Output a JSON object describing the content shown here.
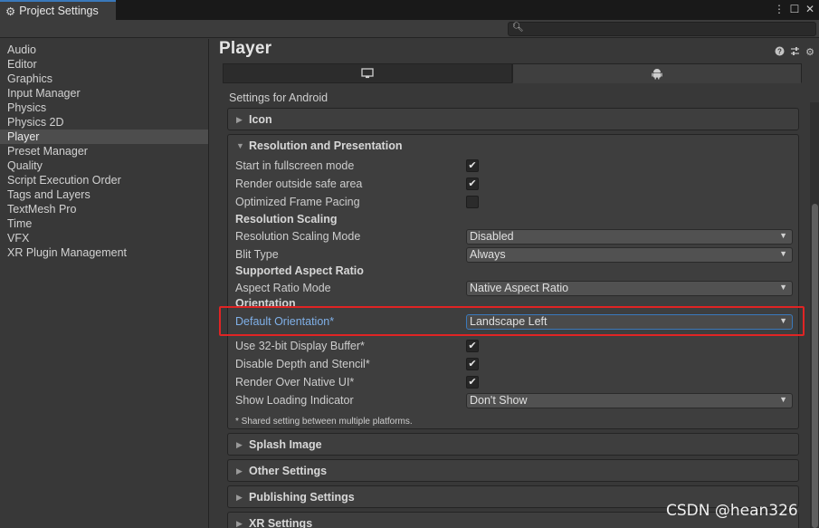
{
  "window": {
    "tab_title": "Project Settings",
    "controls": [
      "⋮",
      "☐",
      "✕"
    ]
  },
  "search": {
    "placeholder": ""
  },
  "sidebar": {
    "items": [
      {
        "label": "Audio"
      },
      {
        "label": "Editor"
      },
      {
        "label": "Graphics"
      },
      {
        "label": "Input Manager"
      },
      {
        "label": "Physics"
      },
      {
        "label": "Physics 2D"
      },
      {
        "label": "Player",
        "active": true
      },
      {
        "label": "Preset Manager"
      },
      {
        "label": "Quality"
      },
      {
        "label": "Script Execution Order"
      },
      {
        "label": "Tags and Layers"
      },
      {
        "label": "TextMesh Pro"
      },
      {
        "label": "Time"
      },
      {
        "label": "VFX"
      },
      {
        "label": "XR Plugin Management"
      }
    ]
  },
  "main": {
    "title": "Player",
    "header_icons": [
      "help-icon",
      "preset-icon",
      "gear-icon"
    ],
    "platform_tabs": [
      "desktop-icon",
      "android-icon"
    ],
    "settings_for": "Settings for Android",
    "icon_section": "Icon",
    "resolution": {
      "heading": "Resolution and Presentation",
      "start_fullscreen": {
        "label": "Start in fullscreen mode",
        "checked": true
      },
      "render_outside_safe": {
        "label": "Render outside safe area",
        "checked": true
      },
      "optimized_frame_pacing": {
        "label": "Optimized Frame Pacing",
        "checked": false
      },
      "resolution_scaling": "Resolution Scaling",
      "scaling_mode": {
        "label": "Resolution Scaling Mode",
        "value": "Disabled"
      },
      "blit_type": {
        "label": "Blit Type",
        "value": "Always"
      },
      "supported_aspect_ratio": "Supported Aspect Ratio",
      "aspect_ratio_mode": {
        "label": "Aspect Ratio Mode",
        "value": "Native Aspect Ratio"
      },
      "orientation": "Orientation",
      "default_orientation": {
        "label": "Default Orientation*",
        "value": "Landscape Left"
      },
      "display_buffer_32": {
        "label": "Use 32-bit Display Buffer*",
        "checked": true
      },
      "disable_depth_stencil": {
        "label": "Disable Depth and Stencil*",
        "checked": true
      },
      "render_over_native_ui": {
        "label": "Render Over Native UI*",
        "checked": true
      },
      "show_loading_indicator": {
        "label": "Show Loading Indicator",
        "value": "Don't Show"
      },
      "note": "* Shared setting between multiple platforms."
    },
    "sections": {
      "splash_image": "Splash Image",
      "other_settings": "Other Settings",
      "publishing_settings": "Publishing Settings",
      "xr_settings": "XR Settings"
    }
  },
  "watermark": "CSDN @hean326",
  "colors": {
    "highlight_border": "#e02424",
    "accent_blue": "#3a79bb",
    "label_blue": "#7fb0e8"
  }
}
